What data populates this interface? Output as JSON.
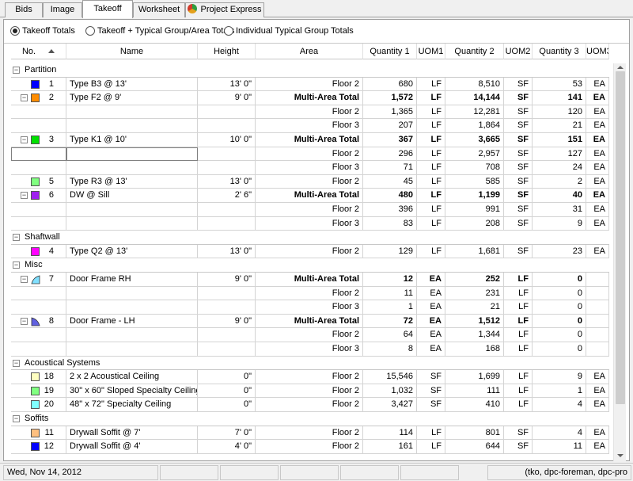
{
  "tabs": [
    {
      "label": "Bids",
      "active": false
    },
    {
      "label": "Image",
      "active": false
    },
    {
      "label": "Takeoff",
      "active": true
    },
    {
      "label": "Worksheet",
      "active": false
    },
    {
      "label": "Project Express",
      "active": false,
      "icon": "project-express-icon"
    }
  ],
  "view_options": [
    {
      "label": "Takeoff Totals",
      "selected": true
    },
    {
      "label": "Takeoff + Typical Group/Area Totals",
      "selected": false
    },
    {
      "label": "Individual Typical Group Totals",
      "selected": false
    }
  ],
  "columns": [
    "No.",
    "Name",
    "Height",
    "Area",
    "Quantity 1",
    "UOM1",
    "Quantity 2",
    "UOM2",
    "Quantity 3",
    "UOM3"
  ],
  "rows": [
    {
      "kind": "group",
      "label": "Partition"
    },
    {
      "kind": "item",
      "no": "1",
      "color": "#0000ff",
      "shape": "square",
      "name": "Type B3 @ 13'",
      "height": "13' 0\"",
      "area": "Floor 2",
      "q1": "680",
      "u1": "LF",
      "q2": "8,510",
      "u2": "SF",
      "q3": "53",
      "u3": "EA",
      "bold": false
    },
    {
      "kind": "item",
      "no": "2",
      "color": "#ff8c00",
      "shape": "square",
      "expand": true,
      "name": "Type F2 @ 9'",
      "height": "9' 0\"",
      "area": "Multi-Area Total",
      "q1": "1,572",
      "u1": "LF",
      "q2": "14,144",
      "u2": "SF",
      "q3": "141",
      "u3": "EA",
      "bold": true
    },
    {
      "kind": "sub",
      "area": "Floor 2",
      "q1": "1,365",
      "u1": "LF",
      "q2": "12,281",
      "u2": "SF",
      "q3": "120",
      "u3": "EA"
    },
    {
      "kind": "sub",
      "area": "Floor 3",
      "q1": "207",
      "u1": "LF",
      "q2": "1,864",
      "u2": "SF",
      "q3": "21",
      "u3": "EA"
    },
    {
      "kind": "item",
      "no": "3",
      "color": "#00e000",
      "shape": "square",
      "expand": true,
      "name": "Type K1 @ 10'",
      "height": "10' 0\"",
      "area": "Multi-Area Total",
      "q1": "367",
      "u1": "LF",
      "q2": "3,665",
      "u2": "SF",
      "q3": "151",
      "u3": "EA",
      "bold": true
    },
    {
      "kind": "sub",
      "area": "Floor 2",
      "q1": "296",
      "u1": "LF",
      "q2": "2,957",
      "u2": "SF",
      "q3": "127",
      "u3": "EA",
      "selected": true
    },
    {
      "kind": "sub",
      "area": "Floor 3",
      "q1": "71",
      "u1": "LF",
      "q2": "708",
      "u2": "SF",
      "q3": "24",
      "u3": "EA"
    },
    {
      "kind": "item",
      "no": "5",
      "color": "#80ff80",
      "shape": "square",
      "name": "Type R3 @ 13'",
      "height": "13' 0\"",
      "area": "Floor 2",
      "q1": "45",
      "u1": "LF",
      "q2": "585",
      "u2": "SF",
      "q3": "2",
      "u3": "EA",
      "bold": false
    },
    {
      "kind": "item",
      "no": "6",
      "color": "#a020f0",
      "shape": "square",
      "expand": true,
      "name": "DW @ Sill",
      "height": "2' 6\"",
      "area": "Multi-Area Total",
      "q1": "480",
      "u1": "LF",
      "q2": "1,199",
      "u2": "SF",
      "q3": "40",
      "u3": "EA",
      "bold": true
    },
    {
      "kind": "sub",
      "area": "Floor 2",
      "q1": "396",
      "u1": "LF",
      "q2": "991",
      "u2": "SF",
      "q3": "31",
      "u3": "EA"
    },
    {
      "kind": "sub",
      "area": "Floor 3",
      "q1": "83",
      "u1": "LF",
      "q2": "208",
      "u2": "SF",
      "q3": "9",
      "u3": "EA"
    },
    {
      "kind": "group",
      "label": "Shaftwall"
    },
    {
      "kind": "item",
      "no": "4",
      "color": "#ff00ff",
      "shape": "square",
      "name": "Type Q2 @ 13'",
      "height": "13' 0\"",
      "area": "Floor 2",
      "q1": "129",
      "u1": "LF",
      "q2": "1,681",
      "u2": "SF",
      "q3": "23",
      "u3": "EA",
      "bold": false
    },
    {
      "kind": "group",
      "label": "Misc"
    },
    {
      "kind": "item",
      "no": "7",
      "color": "#80e0ff",
      "shape": "door-rh",
      "expand": true,
      "name": "Door Frame RH",
      "height": "9' 0\"",
      "area": "Multi-Area Total",
      "q1": "12",
      "u1": "EA",
      "q2": "252",
      "u2": "LF",
      "q3": "0",
      "u3": "",
      "bold": true
    },
    {
      "kind": "sub",
      "area": "Floor 2",
      "q1": "11",
      "u1": "EA",
      "q2": "231",
      "u2": "LF",
      "q3": "0",
      "u3": ""
    },
    {
      "kind": "sub",
      "area": "Floor 3",
      "q1": "1",
      "u1": "EA",
      "q2": "21",
      "u2": "LF",
      "q3": "0",
      "u3": ""
    },
    {
      "kind": "item",
      "no": "8",
      "color": "#6060e0",
      "shape": "door-lh",
      "expand": true,
      "name": "Door Frame - LH",
      "height": "9' 0\"",
      "area": "Multi-Area Total",
      "q1": "72",
      "u1": "EA",
      "q2": "1,512",
      "u2": "LF",
      "q3": "0",
      "u3": "",
      "bold": true
    },
    {
      "kind": "sub",
      "area": "Floor 2",
      "q1": "64",
      "u1": "EA",
      "q2": "1,344",
      "u2": "LF",
      "q3": "0",
      "u3": ""
    },
    {
      "kind": "sub",
      "area": "Floor 3",
      "q1": "8",
      "u1": "EA",
      "q2": "168",
      "u2": "LF",
      "q3": "0",
      "u3": ""
    },
    {
      "kind": "group",
      "label": "Acoustical Systems"
    },
    {
      "kind": "item",
      "no": "18",
      "color": "#ffffc0",
      "shape": "square",
      "name": "2 x 2 Acoustical Ceiling",
      "height": "0\"",
      "area": "Floor 2",
      "q1": "15,546",
      "u1": "SF",
      "q2": "1,699",
      "u2": "LF",
      "q3": "9",
      "u3": "EA",
      "bold": false
    },
    {
      "kind": "item",
      "no": "19",
      "color": "#80ff80",
      "shape": "square",
      "name": "30\" x 60\" Sloped Specialty Ceiling",
      "height": "0\"",
      "area": "Floor 2",
      "q1": "1,032",
      "u1": "SF",
      "q2": "111",
      "u2": "LF",
      "q3": "1",
      "u3": "EA",
      "bold": false
    },
    {
      "kind": "item",
      "no": "20",
      "color": "#80ffff",
      "shape": "square",
      "name": "48\" x 72\" Specialty Ceiling",
      "height": "0\"",
      "area": "Floor 2",
      "q1": "3,427",
      "u1": "SF",
      "q2": "410",
      "u2": "LF",
      "q3": "4",
      "u3": "EA",
      "bold": false
    },
    {
      "kind": "group",
      "label": "Soffits"
    },
    {
      "kind": "item",
      "no": "11",
      "color": "#ffc080",
      "shape": "square",
      "name": "Drywall Soffit @ 7'",
      "height": "7' 0\"",
      "area": "Floor 2",
      "q1": "114",
      "u1": "LF",
      "q2": "801",
      "u2": "SF",
      "q3": "4",
      "u3": "EA",
      "bold": false
    },
    {
      "kind": "item",
      "no": "12",
      "color": "#0000ff",
      "shape": "square",
      "name": "Drywall Soffit @ 4'",
      "height": "4' 0\"",
      "area": "Floor 2",
      "q1": "161",
      "u1": "LF",
      "q2": "644",
      "u2": "SF",
      "q3": "11",
      "u3": "EA",
      "bold": false
    }
  ],
  "status": {
    "date": "Wed, Nov 14, 2012",
    "user": "(tko, dpc-foreman, dpc-pro"
  }
}
